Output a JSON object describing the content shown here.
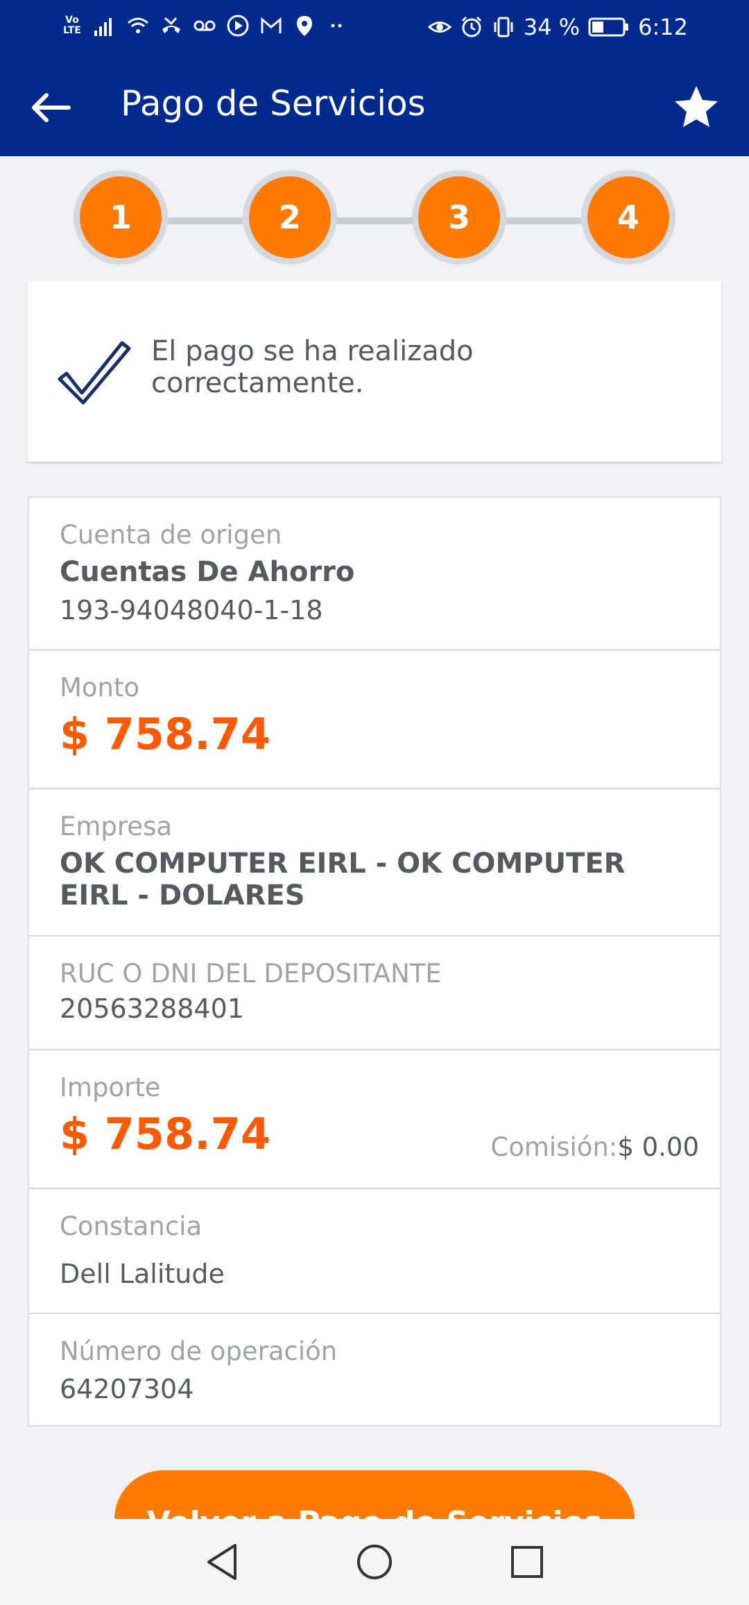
{
  "status_bar": {
    "network_label": "Vo LTE",
    "battery_percent": "34 %",
    "time": "6:12",
    "icons": [
      "signal-icon",
      "wifi-icon",
      "missed-call-icon",
      "voicemail-icon",
      "play-icon",
      "gmail-icon",
      "location-icon",
      "more-dots-icon",
      "eye-icon",
      "alarm-icon",
      "vibrate-icon",
      "battery-icon"
    ]
  },
  "app_bar": {
    "title": "Pago de Servicios",
    "back_icon": "arrow-left-icon",
    "favorite_icon": "star-icon"
  },
  "stepper": {
    "steps": [
      "1",
      "2",
      "3",
      "4"
    ],
    "color": "#ff7a00"
  },
  "success": {
    "message": "El pago se ha realizado correctamente.",
    "icon": "checkmark-icon"
  },
  "details": {
    "origin": {
      "label": "Cuenta de origen",
      "account_type": "Cuentas De Ahorro",
      "account_number": "193-94048040-1-18"
    },
    "amount": {
      "label": "Monto",
      "value": "$ 758.74"
    },
    "company": {
      "label": "Empresa",
      "value": "OK COMPUTER EIRL - OK COMPUTER EIRL - DOLARES"
    },
    "depositor": {
      "label": "RUC O DNI DEL DEPOSITANTE",
      "value": "20563288401"
    },
    "total": {
      "label": "Importe",
      "value": "$ 758.74",
      "commission_label": "Comisión:",
      "commission_value": "$ 0.00"
    },
    "receipt": {
      "label": "Constancia",
      "value": "Dell Lalitude"
    },
    "operation": {
      "label": "Número de operación",
      "value": "64207304"
    }
  },
  "actions": {
    "return_label": "Volver a Pago de Servicios"
  },
  "colors": {
    "brand_blue": "#002a8d",
    "accent_orange": "#ff7a00",
    "amount_orange": "#ff5a00"
  }
}
